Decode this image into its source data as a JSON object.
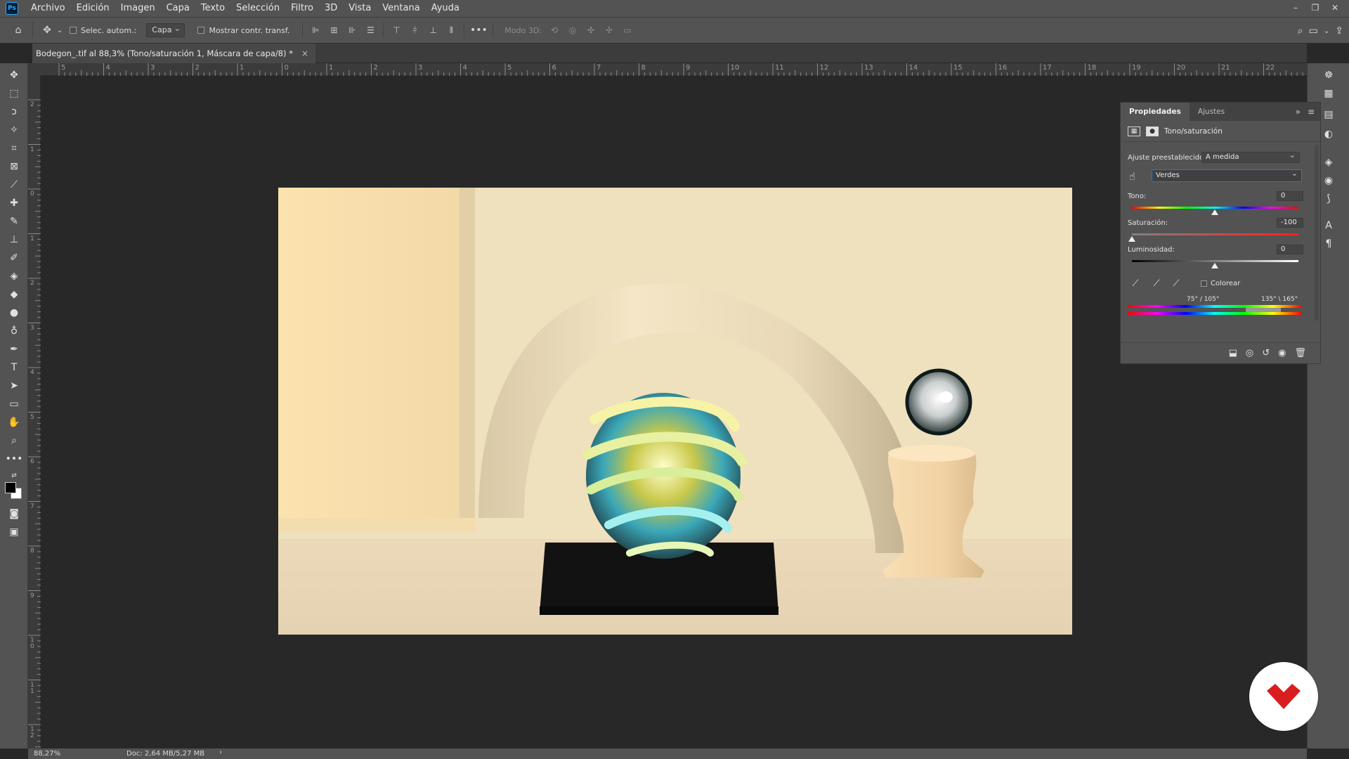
{
  "app": {
    "logo": "Ps"
  },
  "menu": [
    "Archivo",
    "Edición",
    "Imagen",
    "Capa",
    "Texto",
    "Selección",
    "Filtro",
    "3D",
    "Vista",
    "Ventana",
    "Ayuda"
  ],
  "window_controls": {
    "minimize": "–",
    "restore": "❐",
    "close": "✕"
  },
  "options": {
    "auto_select_label": "Selec. autom.:",
    "auto_select_value": "Capa",
    "show_transform_label": "Mostrar contr. transf.",
    "mode_3d_label": "Modo 3D:"
  },
  "document_tab": {
    "title": "Bodegon_.tif al 88,3% (Tono/saturación 1, Máscara de capa/8) *",
    "close": "×"
  },
  "ruler": {
    "top_ticks": [
      "5",
      "4",
      "3",
      "2",
      "1",
      "0",
      "1",
      "2",
      "3",
      "4",
      "5",
      "6",
      "7",
      "8",
      "9",
      "10",
      "11",
      "12",
      "13",
      "14",
      "15",
      "16",
      "17",
      "18",
      "19",
      "20",
      "21",
      "22"
    ],
    "left_ticks": [
      "2",
      "1",
      "0",
      "1",
      "2",
      "3",
      "4",
      "5",
      "6",
      "7",
      "8",
      "9",
      "1\n0",
      "1\n1",
      "1\n2"
    ]
  },
  "properties": {
    "tabs": [
      "Propiedades",
      "Ajustes"
    ],
    "collapse": "»",
    "menu": "≡",
    "title": "Tono/saturación",
    "preset_label": "Ajuste preestablecido:",
    "preset_value": "A medida",
    "channel_value": "Verdes",
    "hue_label": "Tono:",
    "hue_value": "0",
    "saturation_label": "Saturación:",
    "saturation_value": "-100",
    "lightness_label": "Luminosidad:",
    "lightness_value": "0",
    "colorize_label": "Colorear",
    "range_left": "75° / 105°",
    "range_right": "135° \\ 165°"
  },
  "status": {
    "zoom": "88,27%",
    "doc_info": "Doc: 2,64 MB/5,27 MB",
    "arrow": "›"
  },
  "colors": {
    "chrome": "#535353",
    "canvas_bg": "#282828",
    "accent_blue": "#2d78c8",
    "badge_red": "#d81e1e"
  }
}
